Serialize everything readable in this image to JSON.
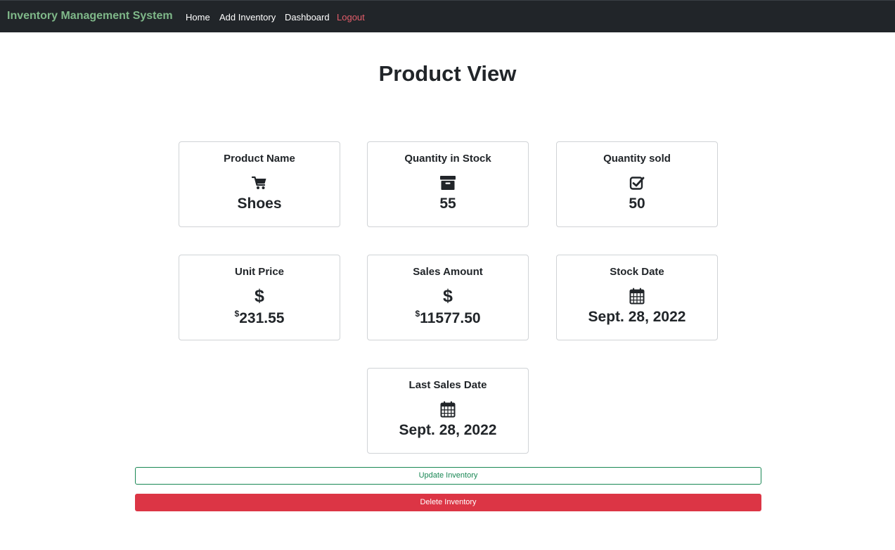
{
  "navbar": {
    "brand": "Inventory Management System",
    "links": {
      "home": "Home",
      "add_inventory": "Add Inventory",
      "dashboard": "Dashboard",
      "logout": "Logout"
    },
    "colors": {
      "background": "#212529",
      "brand": "#7fb889",
      "logout": "#e35d6a"
    }
  },
  "page": {
    "title": "Product View"
  },
  "cards": {
    "product_name": {
      "label": "Product Name",
      "icon": "cart-icon",
      "value": "Shoes"
    },
    "quantity_in_stock": {
      "label": "Quantity in Stock",
      "icon": "archive-box-icon",
      "value": "55"
    },
    "quantity_sold": {
      "label": "Quantity sold",
      "icon": "checkbox-checked-icon",
      "value": "50"
    },
    "unit_price": {
      "label": "Unit Price",
      "icon": "dollar-icon",
      "currency": "$",
      "value": "231.55"
    },
    "sales_amount": {
      "label": "Sales Amount",
      "icon": "dollar-icon",
      "currency": "$",
      "value": "11577.50"
    },
    "stock_date": {
      "label": "Stock Date",
      "icon": "calendar-icon",
      "value": "Sept. 28, 2022"
    },
    "last_sales_date": {
      "label": "Last Sales Date",
      "icon": "calendar-icon",
      "value": "Sept. 28, 2022"
    }
  },
  "actions": {
    "update_label": "Update Inventory",
    "delete_label": "Delete Inventory",
    "colors": {
      "update": "#198754",
      "delete": "#dc3545"
    }
  }
}
